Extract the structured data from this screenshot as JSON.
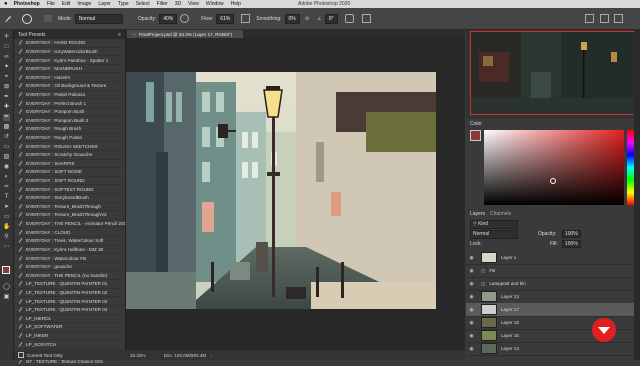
{
  "menubar": {
    "apple": "",
    "items": [
      "Photoshop",
      "File",
      "Edit",
      "Image",
      "Layer",
      "Type",
      "Select",
      "Filter",
      "3D",
      "View",
      "Window",
      "Help"
    ],
    "window_title": "Adobe Photoshop 2020"
  },
  "options": {
    "mode_label": "Mode:",
    "mode_value": "Normal",
    "opacity_label": "Opacity:",
    "opacity_value": "40%",
    "flow_label": "Flow:",
    "flow_value": "61%",
    "smoothing_label": "Smoothing:",
    "smoothing_value": "0%",
    "angle_value": "0°"
  },
  "presets": {
    "title": "Tool Presets",
    "items": [
      "EVERYDAY : HARD ROUND",
      "EVERYDAY : IcicyWatercolorBrush",
      "EVERYDAY : Kyle's Paintbox - Spatter 1",
      "EVERYDAY : MAINBRUSH",
      "EVERYDAY : Hazelrir",
      "EVERYDAY : Oil Background & Texture",
      "EVERYDAY : Pastel Palooza",
      "EVERYDAY : Perfect Brush 1",
      "EVERYDAY : Pompom Bush",
      "EVERYDAY : Pompom Bush 2",
      "EVERYDAY : Rough Brush",
      "EVERYDAY : Rough Pastel",
      "EVERYDAY : ROUGH SKETCHER",
      "EVERYDAY : Scratchy Gouache",
      "EVERYDAY : SHARPIE",
      "EVERYDAY : SOFT NOISE",
      "EVERYDAY : SOFT ROUND",
      "EVERYDAY : SOFTEST ROUND",
      "EVERYDAY : StoryboardBrush",
      "EVERYDAY : Texture_BrushThrough",
      "EVERYDAY : Texture_BrushThroughV2",
      "EVERYDAY : THE PENCIL - Animator Pencil 2018",
      "EVERYDAY : CLOUD",
      "EVERYDAY : Trees, WaterColour Soft",
      "EVERYDAY : Kyle's Halftone - MIZ 30",
      "EVERYDAY : Watercolour FB",
      "EVERYDAY : gouache",
      "EVERYDAY : THE PENCIL (no transfer)",
      "LP_TEXTURE : QUENTIN PAINTER 01",
      "LP_TEXTURE : QUENTIN PAINTER 02",
      "LP_TEXTURE : QUENTIN PAINTER 03",
      "LP_TEXTURE : QUENTIN PAINTER 04",
      "LP_INKROL",
      "LP_SOFTWATER",
      "LP_INKER",
      "LP_SCRATCH",
      "NT : EVERYDAY : Pencil 4H",
      "NT : TEXTURE : Texture Chance Grill"
    ],
    "footer": "Current Tool Only"
  },
  "document": {
    "tab_title": "FinalProject.psd @ 33.3% (Layer 17, RGB/8*)",
    "zoom": "33.33%",
    "doc_info": "Doc: 103.0M/993.4M"
  },
  "color": {
    "title": "Color"
  },
  "layers": {
    "tabs": [
      "Layers",
      "Channels"
    ],
    "kind": "Kind",
    "blend_mode": "Normal",
    "opacity_label": "Opacity:",
    "opacity_value": "100%",
    "lock_label": "Lock:",
    "fill_label": "Fill:",
    "fill_value": "100%",
    "items": [
      {
        "name": "Layer 1",
        "selected": false
      },
      {
        "name": "FB",
        "selected": false
      },
      {
        "name": "Lamppost and bin",
        "selected": false
      },
      {
        "name": "Layer 13",
        "selected": false
      },
      {
        "name": "Layer 17",
        "selected": true
      },
      {
        "name": "Layer 16",
        "selected": false
      },
      {
        "name": "Layer 15",
        "selected": false
      },
      {
        "name": "Layer 14",
        "selected": false
      }
    ]
  },
  "colors": {
    "accent": "#e02020",
    "selection": "#5a5a5a"
  }
}
